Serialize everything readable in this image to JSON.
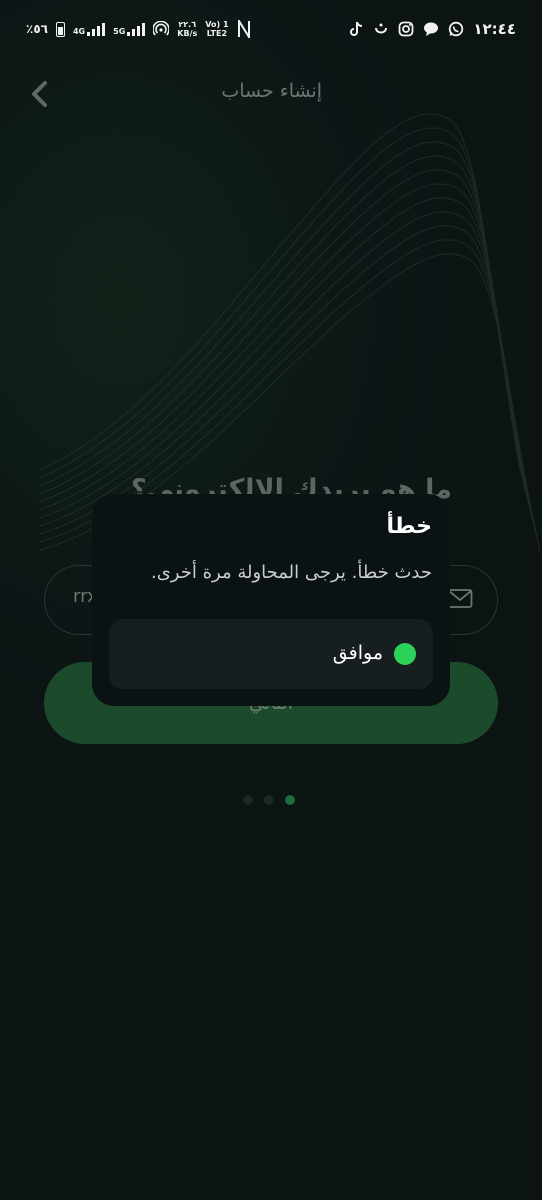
{
  "status_bar": {
    "time": "١٢:٤٤",
    "battery": "٪٥٦",
    "network_1": "4G",
    "network_2": "5G",
    "speed_value": "٢٢.٦",
    "speed_unit": "KB/s",
    "volte_1": "Vo) 1",
    "volte_2": "LTE2",
    "right_icons": [
      "whatsapp-icon",
      "chat-bubble-icon",
      "instagram-icon",
      "noon-icon",
      "tiktok-icon"
    ]
  },
  "header": {
    "title": "إنشاء حساب",
    "back_icon": "chevron-left-icon"
  },
  "form": {
    "question": "ما هو بريدك الإلكتروني؟",
    "email_value": "rrx",
    "email_icon": "mail-icon",
    "next_label": "التالي"
  },
  "pager": {
    "count": 3,
    "active": 3
  },
  "dialog": {
    "title": "خطأ",
    "message": "حدث خطأ. يرجى المحاولة مرة أخرى.",
    "option_label": "موافق",
    "option_selected": true
  },
  "colors": {
    "accent": "#2ed158",
    "background": "#0d1514",
    "dialog": "#0b1214",
    "option": "#171e1f"
  }
}
